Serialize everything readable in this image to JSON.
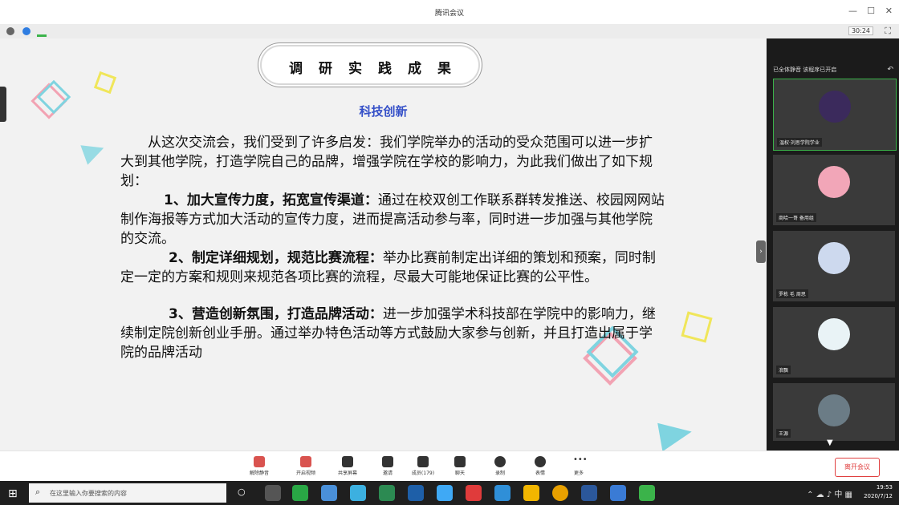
{
  "window": {
    "title": "腾讯会议"
  },
  "infobar": {
    "timer": "30:24"
  },
  "slide": {
    "heading": "调研实践成果",
    "subtitle": "科技创新",
    "paragraphs": [
      {
        "lead": "",
        "text": "从这次交流会，我们受到了许多启发：我们学院举办的活动的受众范围可以进一步扩大到其他学院，打造学院自己的品牌，增强学院在学校的影响力，为此我们做出了如下规划："
      },
      {
        "lead": "1、加大宣传力度，拓宽宣传渠道：",
        "text": "通过在校双创工作联系群转发推送、校园网网站制作海报等方式加大活动的宣传力度，进而提高活动参与率，同时进一步加强与其他学院的交流。"
      },
      {
        "lead": "2、制定详细规划，规范比赛流程：",
        "text": "举办比赛前制定出详细的策划和预案，同时制定一定的方案和规则来规范各项比赛的流程，尽最大可能地保证比赛的公平性。"
      },
      {
        "lead": "3、营造创新氛围，打造品牌活动：",
        "text": "进一步加强学术科技部在学院中的影响力，继续制定院创新创业手册。通过举办特色活动等方式鼓励大家参与创新，并且打造出属于学院的品牌活动"
      }
    ]
  },
  "panel": {
    "header": "已全体静音 该程序已开启",
    "participants": [
      {
        "name": "温权·刘思学院学业",
        "avatar_color": "#3b2a5c"
      },
      {
        "name": "商哈一哥 备用组",
        "avatar_color": "#f2a6b8"
      },
      {
        "name": "罗栋 毛 周思",
        "avatar_color": "#cdd9ee"
      },
      {
        "name": "浪飘",
        "avatar_color": "#e9f3f6"
      },
      {
        "name": "王源",
        "avatar_color": "#6b7c86"
      }
    ]
  },
  "toolbar": {
    "buttons": [
      {
        "label": "解除静音",
        "icon": "mic-icon"
      },
      {
        "label": "开启视频",
        "icon": "camera-icon"
      },
      {
        "label": "共享屏幕",
        "icon": "screen-share-icon"
      },
      {
        "label": "邀请",
        "icon": "invite-icon"
      },
      {
        "label": "成员(179)",
        "icon": "members-icon"
      },
      {
        "label": "聊天",
        "icon": "chat-icon"
      },
      {
        "label": "录制",
        "icon": "record-icon"
      },
      {
        "label": "表情",
        "icon": "emoji-icon"
      },
      {
        "label": "更多",
        "icon": "more-icon"
      }
    ],
    "leave": "离开会议"
  },
  "taskbar": {
    "search_placeholder": "在这里输入你要搜索的内容",
    "time": "19:53",
    "date": "2020/7/12",
    "ime": "中"
  },
  "colors": {
    "accent_blue": "#3550c8",
    "leave_red": "#e04040"
  }
}
